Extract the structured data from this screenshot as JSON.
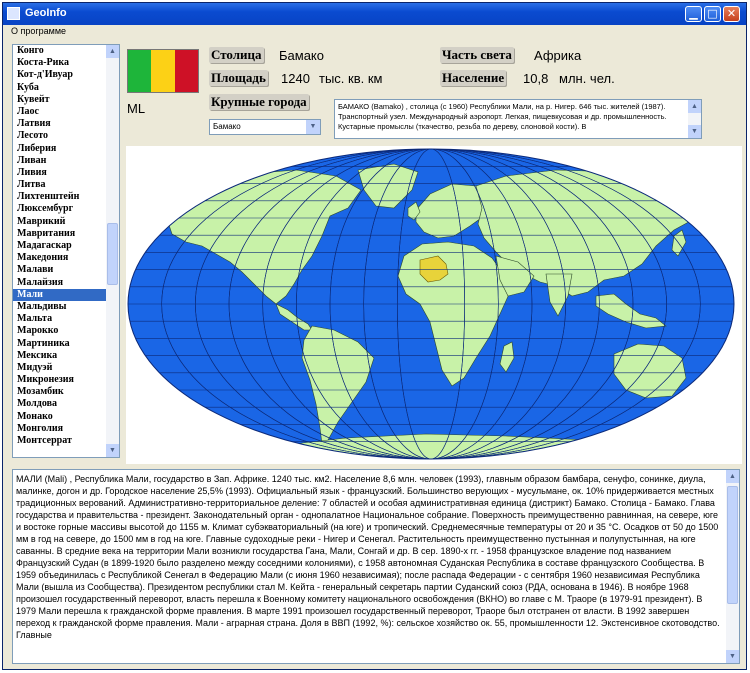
{
  "window": {
    "title": "GeoInfo"
  },
  "menu": {
    "about": "О программе"
  },
  "countries": [
    "Конго",
    "Коста-Рика",
    "Кот-д'Ивуар",
    "Куба",
    "Кувейт",
    "Лаос",
    "Латвия",
    "Лесото",
    "Либерия",
    "Ливан",
    "Ливия",
    "Литва",
    "Лихтенштейн",
    "Люксембург",
    "Маврикий",
    "Мавритания",
    "Мадагаскар",
    "Македония",
    "Малави",
    "Малайзия",
    "Мали",
    "Мальдивы",
    "Мальта",
    "Марокко",
    "Мартиника",
    "Мексика",
    "Мидуэй",
    "Микронезия",
    "Мозамбик",
    "Молдова",
    "Монако",
    "Монголия",
    "Монтсеррат"
  ],
  "selected_country": "Мали",
  "flag": {
    "colors": [
      "#1eb53a",
      "#fcd116",
      "#ce1126"
    ]
  },
  "country_code": "ML",
  "info": {
    "capital_label": "Столица",
    "capital_value": "Бамако",
    "area_label": "Площадь",
    "area_value": "1240",
    "area_unit": "тыс. кв. км",
    "continent_label": "Часть света",
    "continent_value": "Африка",
    "population_label": "Население",
    "population_value": "10,8",
    "population_unit": "млн. чел.",
    "cities_label": "Крупные города"
  },
  "city_select": {
    "value": "Бамако"
  },
  "city_description": "БАМАКО (Bamako) , столица (с 1960) Республики Мали, на р. Нигер. 646 тыс. жителей (1987). Транспортный узел. Международный аэропорт. Легкая, пищевкусовая и др. промышленность. Кустарные промыслы (ткачество, резьба по дереву, слоновой кости). В",
  "country_description": "МАЛИ (Mali) , Республика Мали, государство в Зап. Африке. 1240 тыс. км2. Население 8,6 млн. человек (1993), главным образом бамбара, сенуфо, сонинке, диула, малинке, догон и др. Городское население 25,5% (1993). Официальный язык - французский. Большинство верующих - мусульмане, ок. 10% придерживается местных традиционных верований. Административно-территориальное деление: 7 областей и особая административная единица (дистрикт) Бамако. Столица - Бамако. Глава государства и правительства - президент. Законодательный орган - однопалатное Национальное собрание. Поверхность преимущественно равнинная, на севере, юге и востоке горные массивы высотой до 1155 м. Климат субэкваториальный (на юге) и тропический. Среднемесячные температуры от 20 и 35 °С. Осадков от 50 до 1500 мм в год на севере, до 1500 мм в год на юге. Главные судоходные реки - Нигер и Сенегал. Растительность преимущественно пустынная и полупустынная, на юге саванны. В средние века на территории Мали возникли государства Гана, Мали, Сонгай и др. В сер. 1890-х гг. - 1958 французское владение под названием Французский Судан (в 1899-1920 было разделено между соседними колониями), с 1958 автономная Суданская Республика в составе французского Сообщества. В 1959 объединилась с Республикой Сенегал в Федерацию Мали (с июня 1960 независимая); после распада Федерации - с сентября 1960 независимая Республика Мали (вышла из Сообщества). Президентом республики стал М. Кейта - генеральный секретарь партии Суданский союз (РДА, основана в 1946). В ноябре 1968 произошел государственный переворот, власть перешла к Военному комитету национального освобождения (ВКНО) во главе с М. Траоре (в 1979-91 президент). В 1979 Мали перешла к гражданской форме правления. В марте 1991 произошел государственный переворот, Траоре был отстранен от власти. В 1992 завершен переход к гражданской форме правления. Мали - аграрная страна. Доля в ВВП (1992, %): сельское хозяйство ок. 55, промышленности 12. Экстенсивное скотоводство. Главные",
  "map": {
    "ocean_color": "#1a66e6",
    "land_color": "#c8f2a8",
    "highlight_color": "#e8d33a",
    "grid_color": "#0c2a7a"
  }
}
